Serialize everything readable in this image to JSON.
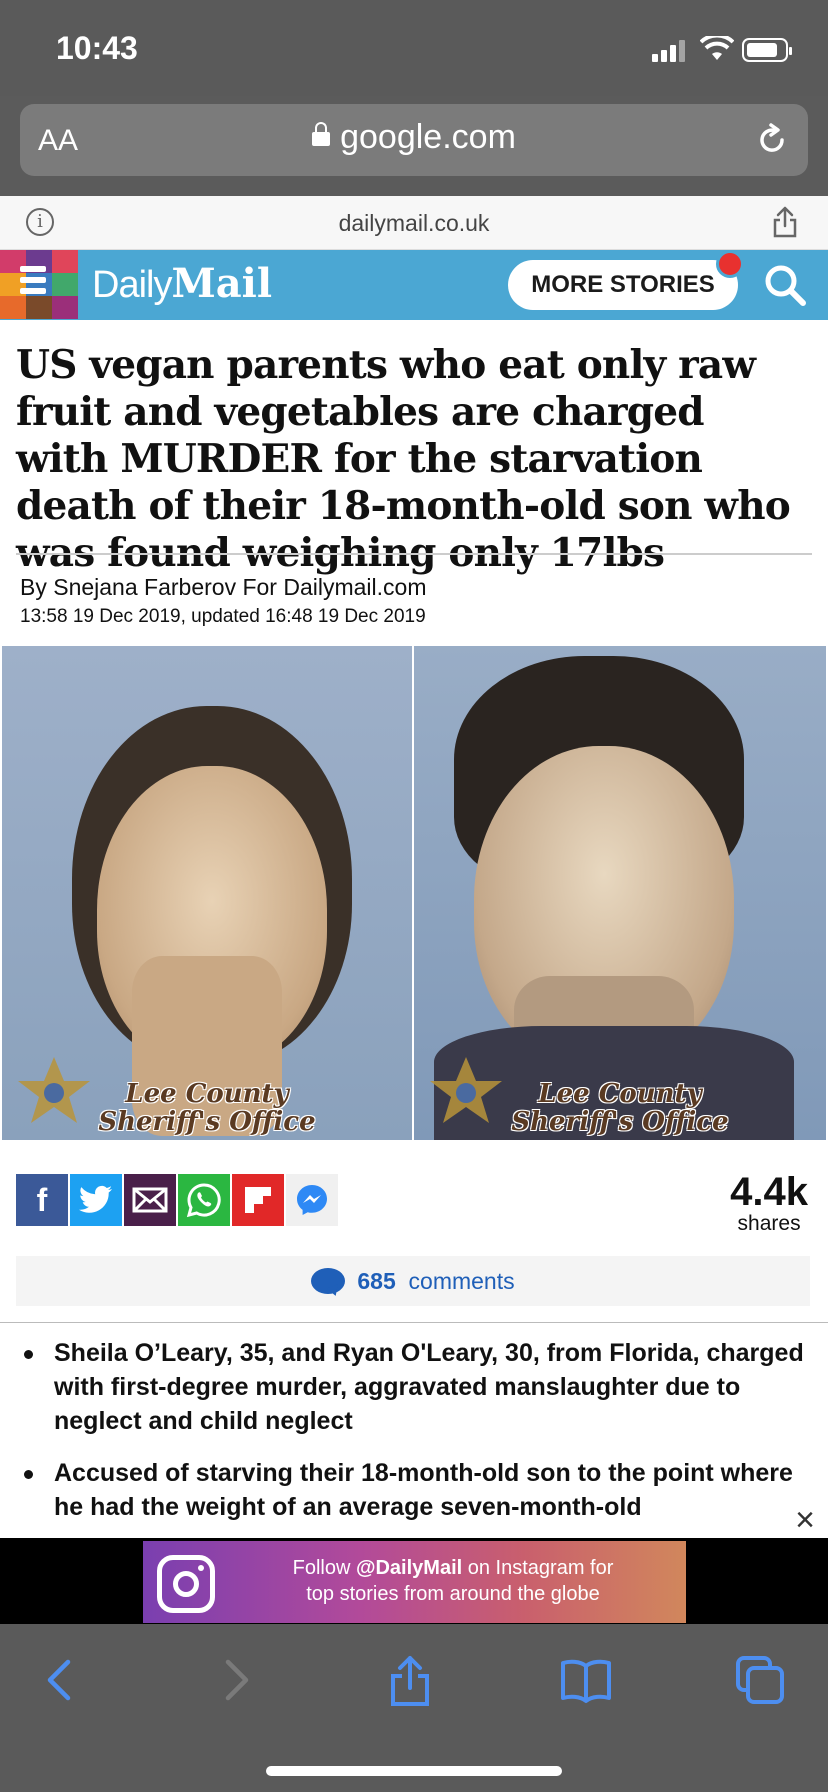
{
  "status_bar": {
    "time": "10:43"
  },
  "browser": {
    "text_size_label": "AA",
    "url": "google.com"
  },
  "site_bar": {
    "domain": "dailymail.co.uk"
  },
  "header": {
    "logo_daily": "Daily",
    "logo_mail": "Mail",
    "more_stories_label": "MORE STORIES",
    "accent_color": "#4ba7d3"
  },
  "article": {
    "headline": "US vegan parents who eat only raw fruit and vegetables are charged with MURDER for the starvation death of their 18-month-old son who was found weighing only 17lbs",
    "byline": "By Snejana Farberov For Dailymail.com",
    "dates": "13:58 19 Dec 2019, updated 16:48 19 Dec 2019",
    "photos": [
      {
        "watermark_line1": "Lee County",
        "watermark_line2": "Sheriff's Office"
      },
      {
        "watermark_line1": "Lee County",
        "watermark_line2": "Sheriff's Office"
      }
    ],
    "social_icons": [
      "facebook-icon",
      "twitter-icon",
      "email-icon",
      "whatsapp-icon",
      "flipboard-icon",
      "messenger-icon"
    ],
    "shares_count": "4.4k",
    "shares_label": "shares",
    "comments_count": "685",
    "comments_label": "comments",
    "bullets": [
      "Sheila O’Leary, 35, and Ryan O'Leary, 30, from Florida, charged with first-degree murder, aggravated manslaughter due to neglect and child neglect",
      "Accused of starving their 18-month-old son to the point where he had the weight of an average seven-month-old"
    ]
  },
  "ad": {
    "text_line1_pre": "Follow ",
    "handle": "@DailyMail",
    "text_line1_post": " on Instagram for",
    "text_line2": "top stories from around the globe",
    "close_label": "×"
  }
}
